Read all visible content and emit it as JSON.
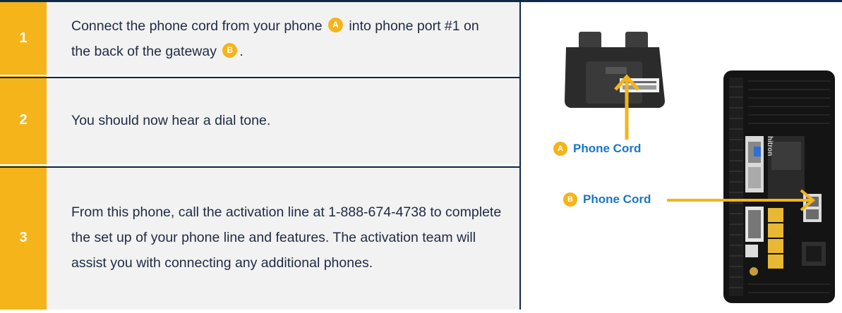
{
  "steps": [
    {
      "number": "1",
      "text_parts": [
        "Connect the phone cord from your phone",
        "into phone port #1 on the back of the gateway",
        "."
      ],
      "badges": [
        "A",
        "B"
      ]
    },
    {
      "number": "2",
      "text": "You should now hear a dial tone."
    },
    {
      "number": "3",
      "text": "From this phone, call the activation line at 1-888-674-4738 to complete the set up of your phone line and features. The activation team will assist you with connecting any additional phones."
    }
  ],
  "callouts": [
    {
      "badge": "A",
      "label": "Phone Cord"
    },
    {
      "badge": "B",
      "label": "Phone Cord"
    }
  ],
  "gateway_brand": "hitron",
  "colors": {
    "accent": "#f4b41a",
    "navy": "#0e2a47",
    "label_blue": "#1a76c8",
    "panel": "#f2f2f2"
  }
}
